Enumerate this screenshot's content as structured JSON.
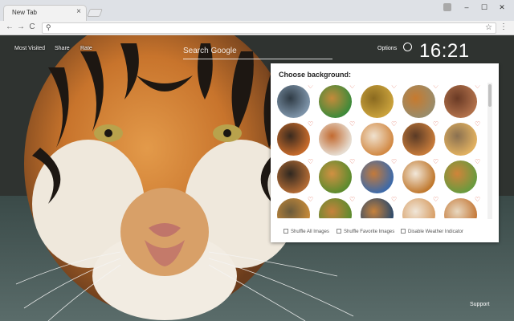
{
  "browser": {
    "tab_title": "New Tab",
    "tab_close": "×",
    "window_controls": [
      "–",
      "☐",
      "✕"
    ],
    "nav": {
      "back": "←",
      "forward": "→",
      "reload": "C"
    },
    "omnibox": {
      "search_glyph": "⚲",
      "star_glyph": "☆",
      "menu_glyph": "⋮"
    }
  },
  "overlay": {
    "nav_items": [
      "Most Visited",
      "Share",
      "Rate"
    ],
    "search_placeholder": "Search Google",
    "options_label": "Options",
    "clock": "16:21",
    "support_label": "Support"
  },
  "panel": {
    "title": "Choose background:",
    "options": [
      "Shuffle All Images",
      "Shuffle Favorite Images",
      "Disable Weather Indicator"
    ],
    "thumbnails": [
      {
        "name": "thumb-1",
        "colors": [
          "#7d93a8",
          "#2f3b45"
        ]
      },
      {
        "name": "thumb-2",
        "colors": [
          "#3f8a3a",
          "#c58a3a"
        ]
      },
      {
        "name": "thumb-3",
        "colors": [
          "#c9a13b",
          "#8a6a20"
        ]
      },
      {
        "name": "thumb-4",
        "colors": [
          "#9a8c6a",
          "#c77a2e"
        ]
      },
      {
        "name": "thumb-5",
        "colors": [
          "#b0704a",
          "#6a3a25"
        ]
      },
      {
        "name": "thumb-6",
        "colors": [
          "#c56a2b",
          "#3a2a1e"
        ]
      },
      {
        "name": "thumb-7",
        "colors": [
          "#e6dcd0",
          "#c26a30"
        ]
      },
      {
        "name": "thumb-8",
        "colors": [
          "#d28a45",
          "#f0e2cf"
        ]
      },
      {
        "name": "thumb-9",
        "colors": [
          "#c57a3a",
          "#5a3a25"
        ]
      },
      {
        "name": "thumb-10",
        "colors": [
          "#e0b060",
          "#8a7050"
        ]
      },
      {
        "name": "thumb-11",
        "colors": [
          "#b06a34",
          "#302820"
        ]
      },
      {
        "name": "thumb-12",
        "colors": [
          "#5d8b2e",
          "#d29042"
        ]
      },
      {
        "name": "thumb-13",
        "colors": [
          "#3e6aa8",
          "#c47a3a"
        ]
      },
      {
        "name": "thumb-14",
        "colors": [
          "#c0792f",
          "#f2e8da"
        ]
      },
      {
        "name": "thumb-15",
        "colors": [
          "#6a9a3e",
          "#d0843a"
        ]
      },
      {
        "name": "thumb-16",
        "colors": [
          "#c58a3a",
          "#6a5a3a"
        ]
      },
      {
        "name": "thumb-17",
        "colors": [
          "#5d8b2e",
          "#c7823c"
        ]
      },
      {
        "name": "thumb-18",
        "colors": [
          "#2e4a6a",
          "#c7823c"
        ]
      },
      {
        "name": "thumb-19",
        "colors": [
          "#d8a068",
          "#f0e6d8"
        ]
      },
      {
        "name": "thumb-20",
        "colors": [
          "#c57a3a",
          "#e8d8c0"
        ]
      }
    ],
    "heart_glyph": "♡"
  },
  "colors": {
    "accent_heart": "#e0604a"
  }
}
